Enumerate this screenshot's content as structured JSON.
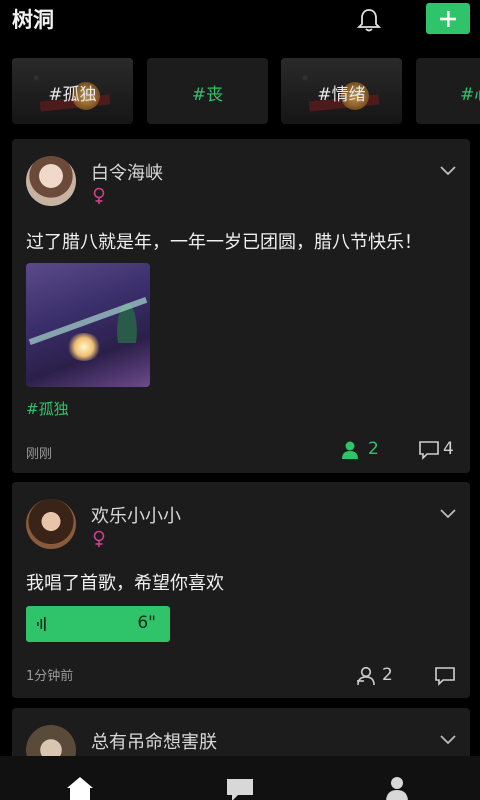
{
  "header": {
    "logo": "树洞",
    "bell_icon": "bell-icon",
    "add_icon": "plus-icon",
    "accent": "#2fc46a"
  },
  "topics": [
    {
      "label": "#孤独",
      "highlight": false
    },
    {
      "label": "#丧",
      "highlight": true
    },
    {
      "label": "#情绪",
      "highlight": false
    },
    {
      "label": "#心",
      "highlight": true
    }
  ],
  "posts": [
    {
      "user": "白令海峡",
      "gender_icon": "female-icon",
      "text": "过了腊八就是年，一年一岁已团圆，腊八节快乐！",
      "tag": "#孤独",
      "time": "刚刚",
      "likes": "2",
      "comments": "4"
    },
    {
      "user": "欢乐小小小",
      "gender_icon": "female-icon",
      "text": "我唱了首歌，希望你喜欢",
      "voice_duration": "6\"",
      "time": "1分钟前",
      "likes": "2"
    },
    {
      "user": "总有吊命想害朕"
    }
  ],
  "tabbar": {
    "icons": [
      "home-icon",
      "chat-icon",
      "profile-icon"
    ]
  }
}
